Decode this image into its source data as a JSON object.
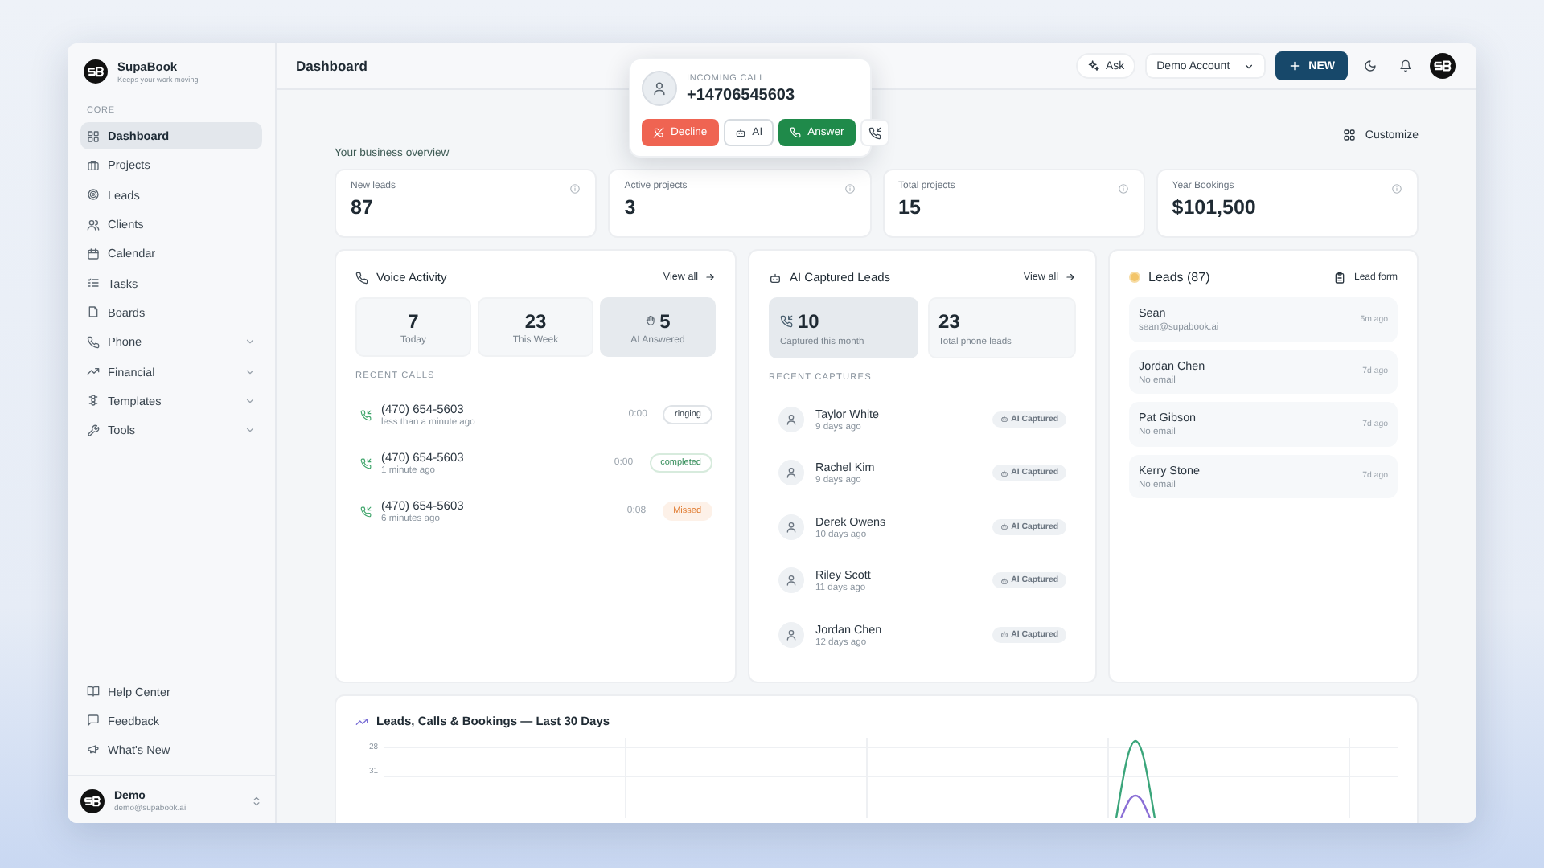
{
  "app": {
    "name": "SupaBook",
    "tagline": "Keeps your work moving"
  },
  "sidebar": {
    "section": "CORE",
    "items": [
      {
        "label": "Dashboard",
        "kind": "link",
        "selected": true
      },
      {
        "label": "Projects",
        "kind": "link",
        "selected": false
      },
      {
        "label": "Leads",
        "kind": "link",
        "selected": false
      },
      {
        "label": "Clients",
        "kind": "link",
        "selected": false
      },
      {
        "label": "Calendar",
        "kind": "link",
        "selected": false
      },
      {
        "label": "Tasks",
        "kind": "link",
        "selected": false
      },
      {
        "label": "Boards",
        "kind": "link",
        "selected": false
      },
      {
        "label": "Phone",
        "kind": "group",
        "selected": false
      },
      {
        "label": "Financial",
        "kind": "group",
        "selected": false
      },
      {
        "label": "Templates",
        "kind": "group",
        "selected": false
      },
      {
        "label": "Tools",
        "kind": "group",
        "selected": false
      }
    ],
    "footer_links": [
      {
        "label": "Help Center"
      },
      {
        "label": "Feedback"
      },
      {
        "label": "What's New"
      }
    ],
    "user": {
      "name": "Demo",
      "email": "demo@supabook.ai"
    }
  },
  "header": {
    "title": "Dashboard",
    "ask": "Ask",
    "account": "Demo Account",
    "new_button": "NEW"
  },
  "incoming_call": {
    "label": "INCOMING CALL",
    "number": "+14706545603",
    "buttons": [
      {
        "kind": "decline",
        "label": "Decline"
      },
      {
        "kind": "ai",
        "label": "AI"
      },
      {
        "kind": "answer",
        "label": "Answer"
      },
      {
        "kind": "transfer"
      }
    ]
  },
  "toolbar": {
    "customize": "Customize"
  },
  "overview_title": "Your business overview",
  "stats": [
    {
      "label": "New leads",
      "value": "87"
    },
    {
      "label": "Active projects",
      "value": "3"
    },
    {
      "label": "Total projects",
      "value": "15"
    },
    {
      "label": "Year Bookings",
      "value": "$101,500"
    }
  ],
  "voice_activity": {
    "title": "Voice Activity",
    "view_all": "View all",
    "tiles": [
      {
        "value": "7",
        "label": "Today",
        "kind": "plain",
        "highlighted": false
      },
      {
        "value": "23",
        "label": "This Week",
        "kind": "plain",
        "highlighted": false
      },
      {
        "value": "5",
        "label": "AI Answered",
        "kind": "ai",
        "highlighted": true
      }
    ],
    "recent_title": "RECENT CALLS",
    "calls": [
      {
        "number": "(470) 654-5603",
        "time": "less than a minute ago",
        "duration": "0:00",
        "status": "ringing",
        "kind": "ringing"
      },
      {
        "number": "(470) 654-5603",
        "time": "1 minute ago",
        "duration": "0:00",
        "status": "completed",
        "kind": "completed"
      },
      {
        "number": "(470) 654-5603",
        "time": "6 minutes ago",
        "duration": "0:08",
        "status": "Missed",
        "kind": "missed"
      }
    ]
  },
  "ai_captured_leads": {
    "title": "AI Captured Leads",
    "view_all": "View all",
    "tiles": [
      {
        "value": "10",
        "label": "Captured this month",
        "kind": "phone",
        "highlighted": true
      },
      {
        "value": "23",
        "label": "Total phone leads",
        "kind": "plain",
        "highlighted": false
      }
    ],
    "recent_title": "RECENT CAPTURES",
    "captures": [
      {
        "name": "Taylor White",
        "time": "9 days ago",
        "badge": "AI Captured"
      },
      {
        "name": "Rachel Kim",
        "time": "9 days ago",
        "badge": "AI Captured"
      },
      {
        "name": "Derek Owens",
        "time": "10 days ago",
        "badge": "AI Captured"
      },
      {
        "name": "Riley Scott",
        "time": "11 days ago",
        "badge": "AI Captured"
      },
      {
        "name": "Jordan Chen",
        "time": "12 days ago",
        "badge": "AI Captured"
      }
    ]
  },
  "leads": {
    "title": "Leads (87)",
    "action": "Lead form",
    "items": [
      {
        "name": "Sean",
        "email": "sean@supabook.ai",
        "time": "5m ago"
      },
      {
        "name": "Jordan Chen",
        "email": "No email",
        "time": "7d ago"
      },
      {
        "name": "Pat Gibson",
        "email": "No email",
        "time": "7d ago"
      },
      {
        "name": "Kerry Stone",
        "email": "No email",
        "time": "7d ago"
      }
    ]
  },
  "chart": {
    "title": "Leads, Calls & Bookings — Last 30 Days",
    "y_tick_labels": [
      "28",
      "31"
    ]
  }
}
